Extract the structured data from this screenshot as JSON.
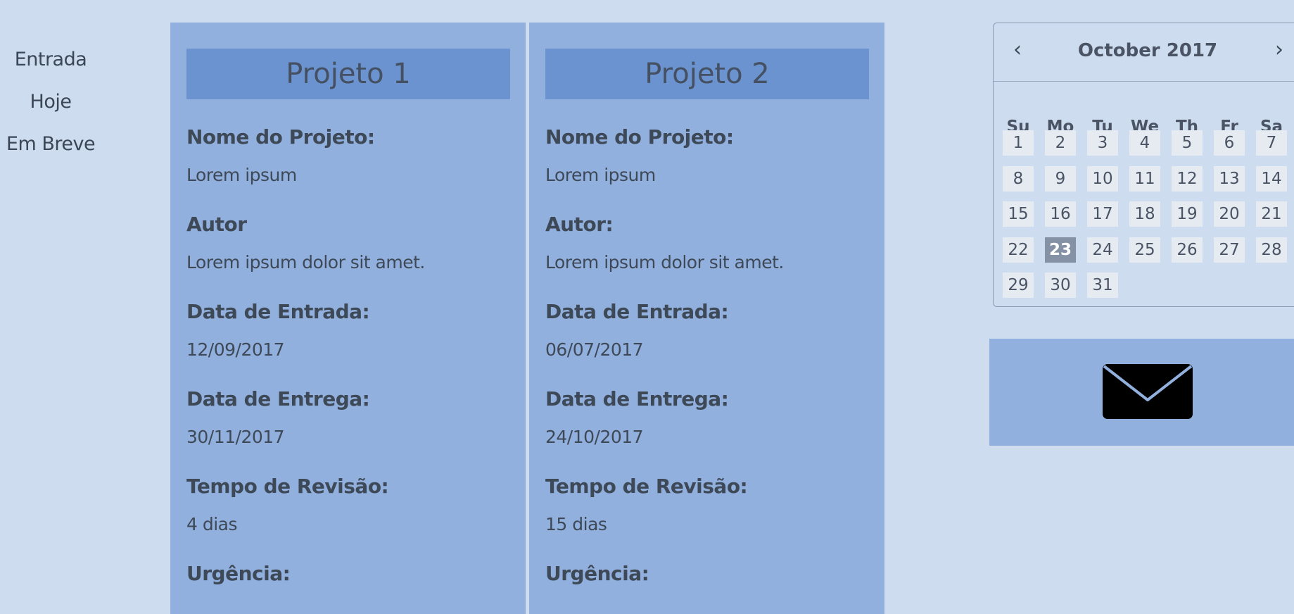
{
  "nav": {
    "items": [
      "Entrada",
      "Hoje",
      "Em Breve"
    ]
  },
  "projects": [
    {
      "title": "Projeto 1",
      "name_label": "Nome do Projeto:",
      "name": "Lorem ipsum",
      "author_label": "Autor",
      "author": "Lorem ipsum dolor sit amet.",
      "entry_label": "Data de Entrada:",
      "entry": "12/09/2017",
      "delivery_label": "Data de Entrega:",
      "delivery": "30/11/2017",
      "review_label": "Tempo de Revisão:",
      "review": "4 dias",
      "urgency_label": "Urgência:"
    },
    {
      "title": "Projeto 2",
      "name_label": "Nome do Projeto:",
      "name": "Lorem ipsum",
      "author_label": "Autor:",
      "author": "Lorem ipsum dolor sit amet.",
      "entry_label": "Data de Entrada:",
      "entry": "06/07/2017",
      "delivery_label": "Data de Entrega:",
      "delivery": "24/10/2017",
      "review_label": "Tempo de Revisão:",
      "review": "15 dias",
      "urgency_label": "Urgência:"
    }
  ],
  "calendar": {
    "title": "October 2017",
    "prev": "‹",
    "next": "›",
    "weekdays": [
      "Su",
      "Mo",
      "Tu",
      "We",
      "Th",
      "Fr",
      "Sa"
    ],
    "days": [
      "1",
      "2",
      "3",
      "4",
      "5",
      "6",
      "7",
      "8",
      "9",
      "10",
      "11",
      "12",
      "13",
      "14",
      "15",
      "16",
      "17",
      "18",
      "19",
      "20",
      "21",
      "22",
      "23",
      "24",
      "25",
      "26",
      "27",
      "28",
      "29",
      "30",
      "31"
    ],
    "selected_day": "23"
  },
  "mail": {
    "icon": "envelope-icon"
  },
  "colors": {
    "background": "#cddcee",
    "card": "#92b0dd",
    "card_header": "#6a93cf",
    "selected_day": "#8592a6"
  }
}
